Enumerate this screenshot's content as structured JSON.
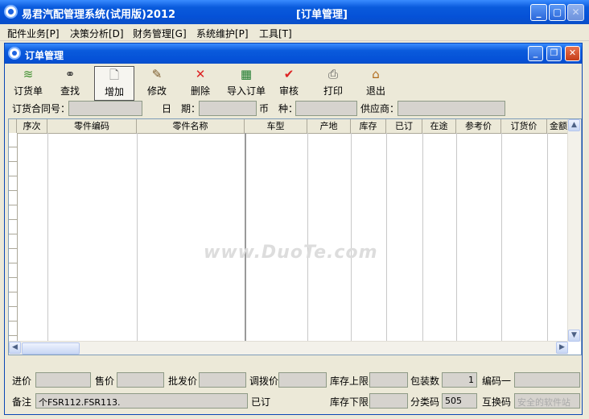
{
  "window": {
    "title": "易君汽配管理系统(试用版)2012",
    "doc_title": "[订单管理]"
  },
  "menu": [
    "配件业务[P]",
    "决策分析[D]",
    "财务管理[G]",
    "系统维护[P]",
    "工具[T]"
  ],
  "child": {
    "title": "订单管理"
  },
  "toolbar": {
    "order": "订货单",
    "find": "查找",
    "add": "增加",
    "edit": "修改",
    "delete": "删除",
    "import": "导入订单",
    "review": "审核",
    "print": "打印",
    "exit": "退出"
  },
  "filters": {
    "contract_label": "订货合同号：",
    "date_label": "日　期：",
    "currency_label": "币　种：",
    "supplier_label": "供应商："
  },
  "grid": {
    "columns": [
      "序次",
      "零件编码",
      "零件名称",
      "车型",
      "产地",
      "库存",
      "已订",
      "在途",
      "参考价",
      "订货价",
      "金额"
    ]
  },
  "footer": {
    "purchase_price": "进价",
    "sale_price": "售价",
    "wholesale_price": "批发价",
    "transfer_price": "调拨价",
    "stock_upper": "库存上限",
    "pack_qty": "包装数",
    "pack_qty_value": "1",
    "code1": "编码一",
    "remark": "备注",
    "remark_value": "个FSR112.FSR113.",
    "ordered": "已订",
    "stock_lower": "库存下限",
    "category_code": "分类码",
    "category_value": "505",
    "interchange_code": "互换码"
  },
  "watermark": {
    "text": "www.DuoTe.com",
    "corner": "安全的软件站"
  }
}
